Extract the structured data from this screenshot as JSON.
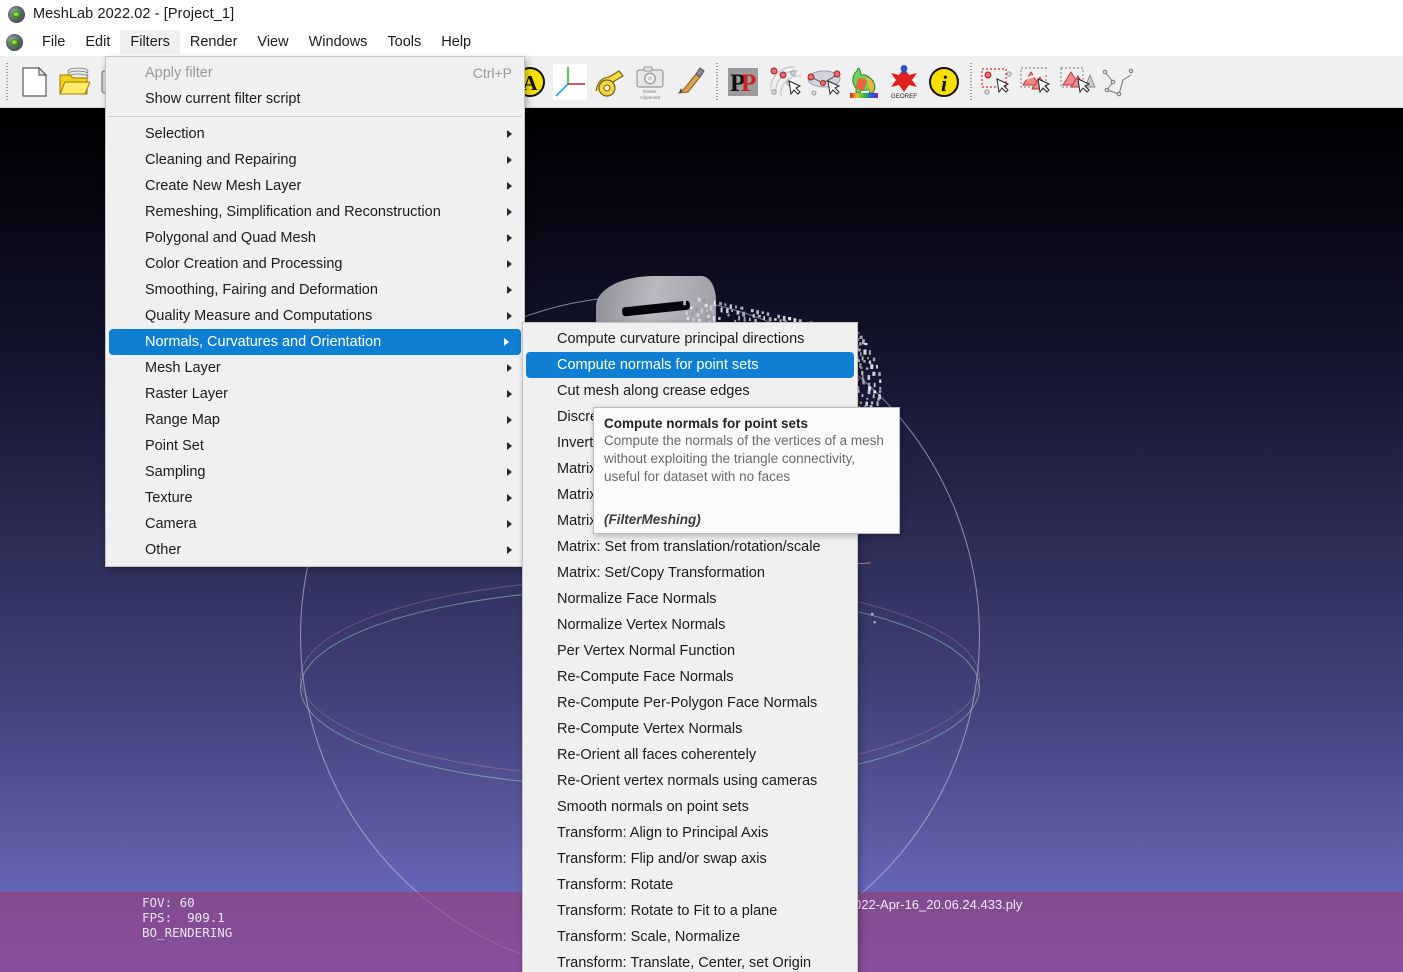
{
  "window": {
    "title": "MeshLab 2022.02 - [Project_1]",
    "app_icon": "meshlab-icon"
  },
  "menubar": {
    "items": [
      {
        "label": "File",
        "active": false
      },
      {
        "label": "Edit",
        "active": false
      },
      {
        "label": "Filters",
        "active": true
      },
      {
        "label": "Render",
        "active": false
      },
      {
        "label": "View",
        "active": false
      },
      {
        "label": "Windows",
        "active": false
      },
      {
        "label": "Tools",
        "active": false
      },
      {
        "label": "Help",
        "active": false
      }
    ]
  },
  "toolbar": {
    "groups": [
      {
        "icons": [
          "new-project-icon",
          "open-project-icon",
          "save-project-icon"
        ]
      },
      {
        "icons": [
          "import-mesh-icon",
          "export-mesh-icon",
          "reload-icon"
        ]
      },
      {
        "icons": [
          "cylinder-light-icon",
          "cylinder-solid-icon"
        ]
      },
      {
        "icons": [
          "wireframe-sphere-icon",
          "axes-xyz-icon"
        ]
      },
      {
        "icons": [
          "globe-wire-icon",
          "text-a-icon",
          "trackball-axes-icon",
          "measure-tape-icon",
          "raster-alignment-icon",
          "paintbrush-icon"
        ]
      },
      {
        "icons": [
          "pp-points-icon",
          "pick-points-icon",
          "align-points-icon",
          "colorize-bunny-icon",
          "georef-icon",
          "info-icon"
        ]
      },
      {
        "icons": [
          "select-vertices-icon",
          "select-faces-icon",
          "select-connected-icon",
          "polyline-icon"
        ]
      }
    ],
    "raster_alignment_label_line1": "Raster",
    "raster_alignment_label_line2": "Alignment",
    "georef_label": "GEOREF"
  },
  "filters_menu": {
    "groups": [
      [
        {
          "label": "Apply filter",
          "shortcut": "Ctrl+P",
          "disabled": true,
          "submenu": false
        },
        {
          "label": "Show current filter script",
          "shortcut": "",
          "disabled": false,
          "submenu": false
        }
      ],
      [
        {
          "label": "Selection",
          "shortcut": "",
          "disabled": false,
          "submenu": true
        },
        {
          "label": "Cleaning and Repairing",
          "shortcut": "",
          "disabled": false,
          "submenu": true
        },
        {
          "label": "Create New Mesh Layer",
          "shortcut": "",
          "disabled": false,
          "submenu": true
        },
        {
          "label": "Remeshing, Simplification and Reconstruction",
          "shortcut": "",
          "disabled": false,
          "submenu": true
        },
        {
          "label": "Polygonal and Quad Mesh",
          "shortcut": "",
          "disabled": false,
          "submenu": true
        },
        {
          "label": "Color Creation and Processing",
          "shortcut": "",
          "disabled": false,
          "submenu": true
        },
        {
          "label": "Smoothing, Fairing and Deformation",
          "shortcut": "",
          "disabled": false,
          "submenu": true
        },
        {
          "label": "Quality Measure and Computations",
          "shortcut": "",
          "disabled": false,
          "submenu": true
        },
        {
          "label": "Normals, Curvatures and Orientation",
          "shortcut": "",
          "disabled": false,
          "submenu": true,
          "selected": true
        },
        {
          "label": "Mesh Layer",
          "shortcut": "",
          "disabled": false,
          "submenu": true
        },
        {
          "label": "Raster Layer",
          "shortcut": "",
          "disabled": false,
          "submenu": true
        },
        {
          "label": "Range Map",
          "shortcut": "",
          "disabled": false,
          "submenu": true
        },
        {
          "label": "Point Set",
          "shortcut": "",
          "disabled": false,
          "submenu": true
        },
        {
          "label": "Sampling",
          "shortcut": "",
          "disabled": false,
          "submenu": true
        },
        {
          "label": "Texture",
          "shortcut": "",
          "disabled": false,
          "submenu": true
        },
        {
          "label": "Camera",
          "shortcut": "",
          "disabled": false,
          "submenu": true
        },
        {
          "label": "Other",
          "shortcut": "",
          "disabled": false,
          "submenu": true
        }
      ]
    ]
  },
  "normals_submenu": {
    "items": [
      {
        "label": "Compute curvature principal directions",
        "selected": false
      },
      {
        "label": "Compute normals for point sets",
        "selected": true
      },
      {
        "label": "Cut mesh along crease edges",
        "selected": false
      },
      {
        "label": "Discre",
        "selected": false,
        "occluded": true
      },
      {
        "label": "Invert",
        "selected": false,
        "occluded": true
      },
      {
        "label": "Matrix",
        "selected": false,
        "occluded": true
      },
      {
        "label": "Matrix",
        "selected": false,
        "occluded": true
      },
      {
        "label": "Matrix",
        "selected": false,
        "occluded": true
      },
      {
        "label": "Matrix: Set from translation/rotation/scale",
        "selected": false
      },
      {
        "label": "Matrix: Set/Copy Transformation",
        "selected": false
      },
      {
        "label": "Normalize Face Normals",
        "selected": false
      },
      {
        "label": "Normalize Vertex Normals",
        "selected": false
      },
      {
        "label": "Per Vertex Normal Function",
        "selected": false
      },
      {
        "label": "Re-Compute Face Normals",
        "selected": false
      },
      {
        "label": "Re-Compute Per-Polygon Face Normals",
        "selected": false
      },
      {
        "label": "Re-Compute Vertex Normals",
        "selected": false
      },
      {
        "label": "Re-Orient all faces coherentely",
        "selected": false
      },
      {
        "label": "Re-Orient vertex normals using cameras",
        "selected": false
      },
      {
        "label": "Smooth normals on point sets",
        "selected": false
      },
      {
        "label": "Transform: Align to Principal Axis",
        "selected": false
      },
      {
        "label": "Transform: Flip and/or swap axis",
        "selected": false
      },
      {
        "label": "Transform: Rotate",
        "selected": false
      },
      {
        "label": "Transform: Rotate to Fit to a plane",
        "selected": false
      },
      {
        "label": "Transform: Scale, Normalize",
        "selected": false
      },
      {
        "label": "Transform: Translate, Center, set Origin",
        "selected": false
      }
    ]
  },
  "tooltip": {
    "title": "Compute normals for point sets",
    "body": "Compute the normals of the vertices of a mesh without exploiting the triangle connectivity, useful for dataset with no faces",
    "plugin": "(FilterMeshing)"
  },
  "viewport": {
    "status_overlay": "FOV: 60\nFPS:  909.1\nBO_RENDERING",
    "fov": "FOV: 60",
    "fps": "FPS:  909.1",
    "rendering_mode": "BO_RENDERING",
    "file_label": "022-Apr-16_20.06.24.433.ply"
  },
  "colors": {
    "menu_highlight": "#0f7fd4",
    "menu_background": "#f0f0f0",
    "titlebar_background": "#ffffff",
    "viewport_top": "#000000",
    "viewport_bottom": "#7272d8",
    "status_band": "#963a78",
    "tooltip_background": "#fbfbfb"
  }
}
